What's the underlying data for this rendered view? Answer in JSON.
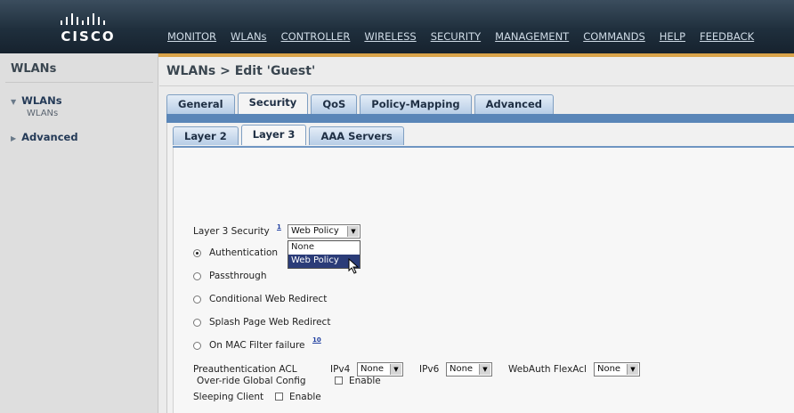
{
  "brand": {
    "logo_text": "CISCO"
  },
  "nav": [
    "MONITOR",
    "WLANs",
    "CONTROLLER",
    "WIRELESS",
    "SECURITY",
    "MANAGEMENT",
    "COMMANDS",
    "HELP",
    "FEEDBACK"
  ],
  "sidebar": {
    "title": "WLANs",
    "items": [
      {
        "label": "WLANs",
        "sub": "WLANs"
      },
      {
        "label": "Advanced"
      }
    ]
  },
  "page": {
    "title": "WLANs > Edit  'Guest'"
  },
  "tabs": [
    "General",
    "Security",
    "QoS",
    "Policy-Mapping",
    "Advanced"
  ],
  "active_tab": "Security",
  "subtabs": [
    "Layer 2",
    "Layer 3",
    "AAA Servers"
  ],
  "active_subtab": "Layer 3",
  "form": {
    "layer3_security_label": "Layer 3 Security",
    "layer3_security_footnote": "1",
    "layer3_security_value": "Web Policy",
    "dropdown_options": [
      "None",
      "Web Policy"
    ],
    "dropdown_highlighted": "Web Policy",
    "radios": [
      {
        "label": "Authentication",
        "checked": true
      },
      {
        "label": "Passthrough",
        "checked": false
      },
      {
        "label": "Conditional Web Redirect",
        "checked": false
      },
      {
        "label": "Splash Page Web Redirect",
        "checked": false
      },
      {
        "label": "On MAC Filter failure",
        "checked": false,
        "footnote": "10"
      }
    ],
    "preauth_label": "Preauthentication ACL",
    "ipv4_label": "IPv4",
    "ipv4_value": "None",
    "ipv6_label": "IPv6",
    "ipv6_value": "None",
    "webauth_label": "WebAuth FlexAcl",
    "webauth_value": "None",
    "sleeping_client_label": "Sleeping Client",
    "sleeping_client_enable": "Enable",
    "override_label": "Over-ride Global Config",
    "override_enable": "Enable"
  }
}
